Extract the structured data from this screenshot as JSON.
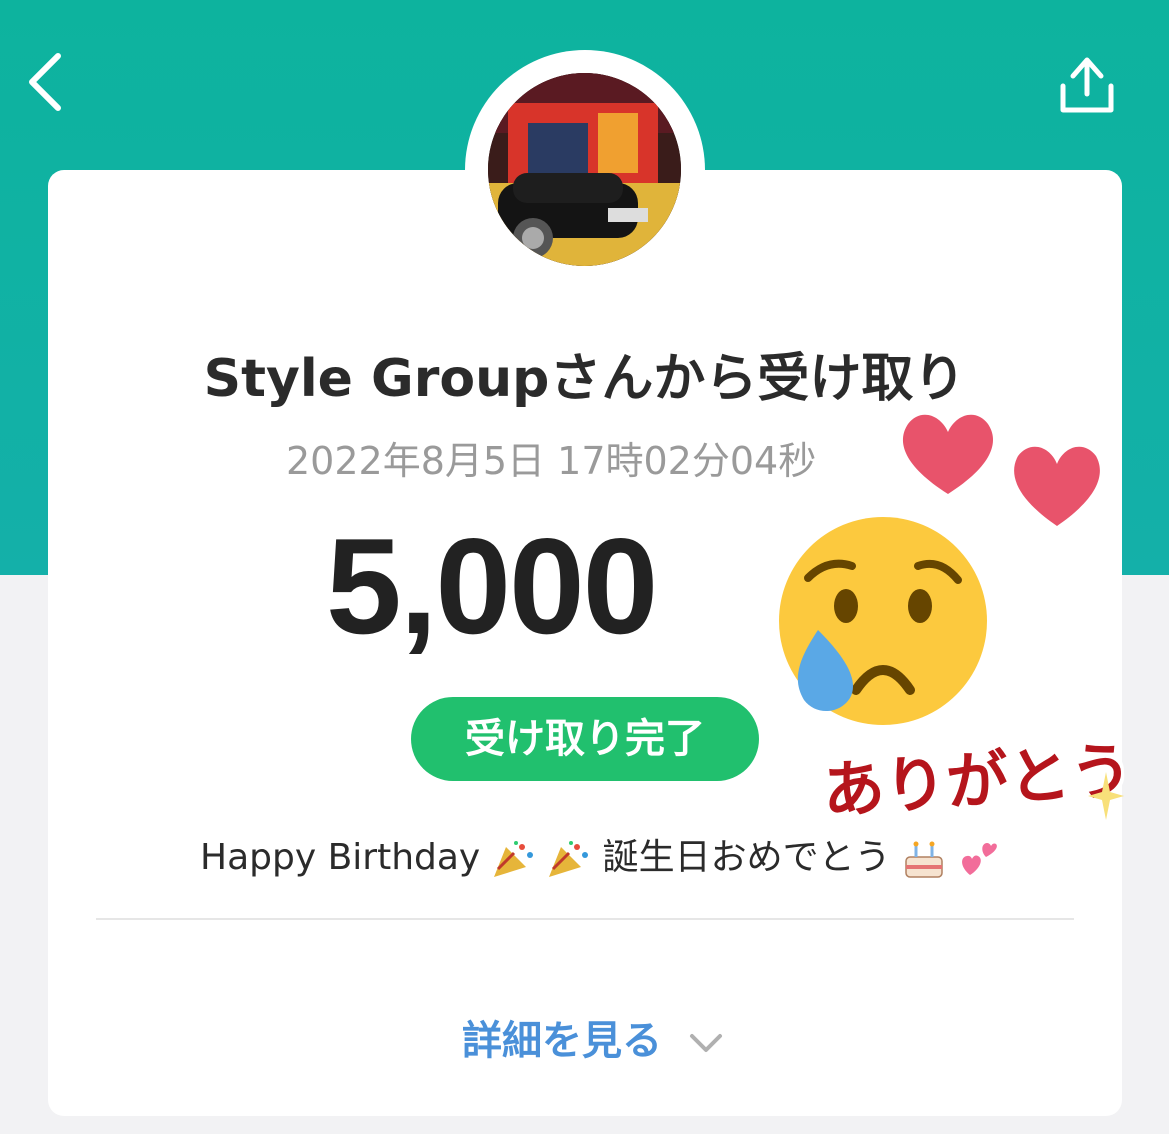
{
  "header": {
    "back_icon": "chevron-left-icon",
    "share_icon": "share-icon",
    "background_color": "#0db39e"
  },
  "card": {
    "title": "Style Groupさんから受け取り",
    "datetime": "2022年8月5日 17時02分04秒",
    "amount": "5,000",
    "status": "受け取り完了",
    "message_text": "Happy Birthday",
    "message_text_2": "誕生日おめでとう",
    "details_label": "詳細を見る",
    "status_color": "#21c06e",
    "link_color": "#4a90d9"
  },
  "stickers": {
    "thanks_text": "ありがとう",
    "thanks_color": "#b5151c",
    "icons": [
      "heart-icon",
      "heart-icon",
      "crying-face-icon",
      "sparkle-icon"
    ]
  }
}
